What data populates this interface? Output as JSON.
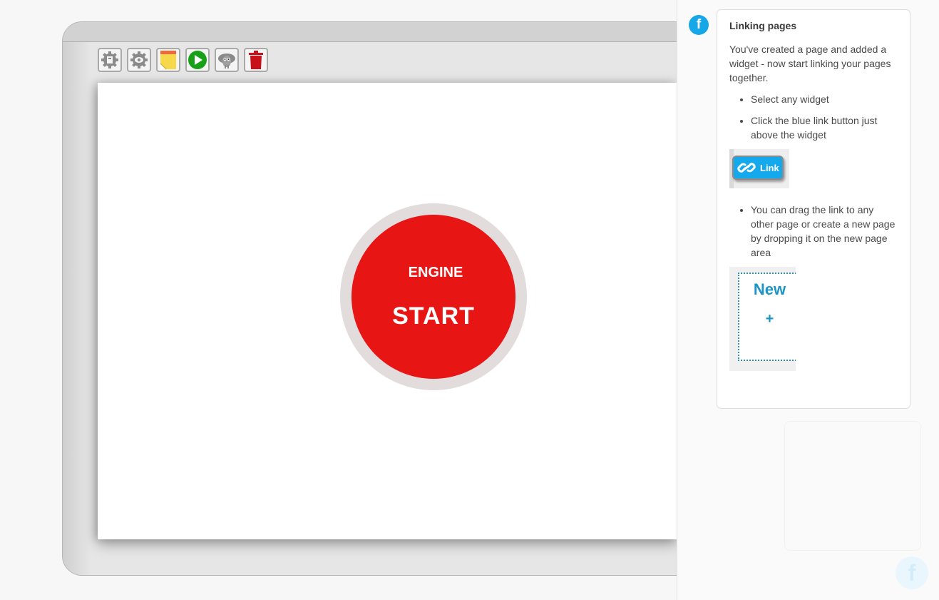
{
  "toolbar": {
    "buttons": [
      {
        "icon": "widget-settings-icon"
      },
      {
        "icon": "page-settings-icon"
      },
      {
        "icon": "sticky-note-icon"
      },
      {
        "icon": "play-icon"
      },
      {
        "icon": "sheep-icon"
      },
      {
        "icon": "trash-icon"
      }
    ]
  },
  "screen": {
    "button": {
      "line1": "ENGINE",
      "line2": "START",
      "color": "#e81515",
      "ring_color": "#e3dcdc"
    }
  },
  "help": {
    "avatar_letter": "f",
    "title": "Linking pages",
    "intro": "You've created a page and added a widget - now start linking your pages together.",
    "bullets_a": [
      "Select any widget",
      "Click the blue link button just above the widget"
    ],
    "link_button_label": "Link",
    "bullets_b": [
      "You can drag the link to any other page or create a new page by dropping it on the new page area"
    ],
    "new_page_label": "New",
    "new_page_plus": "+"
  },
  "colors": {
    "accent": "#16a7e8",
    "play": "#18a018",
    "trash": "#c8101a",
    "note": "#f7d84a"
  }
}
